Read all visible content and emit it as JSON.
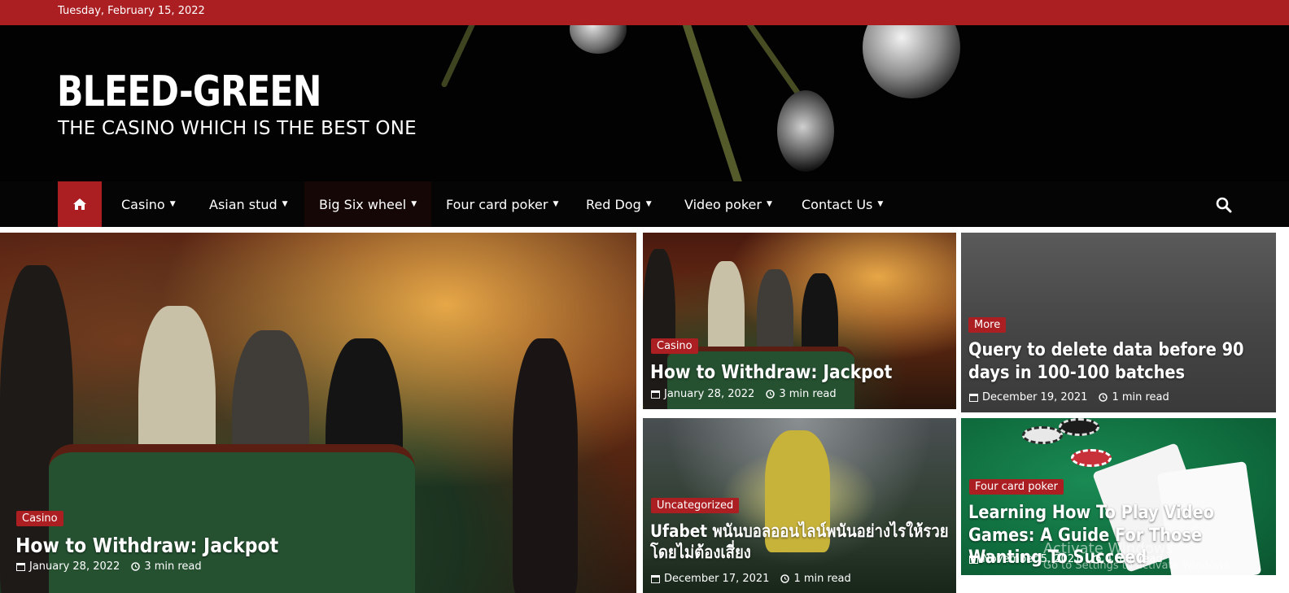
{
  "topbar": {
    "date": "Tuesday, February 15, 2022"
  },
  "header": {
    "site_title": "BLEED-GREEN",
    "tagline": "THE CASINO WHICH IS THE BEST ONE"
  },
  "nav": {
    "home_icon": "home-icon",
    "items": [
      {
        "label": "Casino"
      },
      {
        "label": "Asian stud"
      },
      {
        "label": "Big Six wheel"
      },
      {
        "label": "Four card poker"
      },
      {
        "label": "Red Dog"
      },
      {
        "label": "Video poker"
      },
      {
        "label": "Contact Us"
      }
    ],
    "search_icon": "search-icon"
  },
  "posts": {
    "big": {
      "category": "Casino",
      "title": "How to Withdraw: Jackpot",
      "date": "January 28, 2022",
      "read": "3 min read"
    },
    "top_left": {
      "category": "Casino",
      "title": "How to Withdraw: Jackpot",
      "date": "January 28, 2022",
      "read": "3 min read"
    },
    "top_right": {
      "category": "More",
      "title": "Query to delete data before 90 days in 100-100 batches",
      "date": "December 19, 2021",
      "read": "1 min read"
    },
    "bottom_left": {
      "category": "Uncategorized",
      "title": "Ufabet พนันบอลออนไลน์พนันอย่างไรให้รวยโดยไม่ต้องเสี่ยง",
      "date": "December 17, 2021",
      "read": "1 min read"
    },
    "bottom_right": {
      "category": "Four card poker",
      "title": "Learning How To Play Video Games: A Guide For Those Wanting To Succeed",
      "date": "November 5, 2021",
      "read": "4 min read"
    }
  },
  "watermark": {
    "line1": "Activate Windows",
    "line2": "Go to Settings to activate Windows."
  },
  "colors": {
    "brand": "#ab1e22",
    "nav_bg": "#050505",
    "header_bg": "#020202"
  }
}
